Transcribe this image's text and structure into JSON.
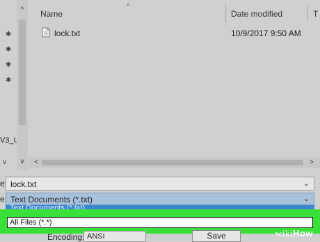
{
  "nav": {
    "label": "V3_U",
    "scroll_up_glyph": "^",
    "scroll_down_glyph": "v",
    "chevron": "v",
    "pin_glyph": "✱"
  },
  "file_list": {
    "columns": {
      "name": "Name",
      "date_modified": "Date modified",
      "type": "T"
    },
    "sort_glyph": "^",
    "files": [
      {
        "name": "lock.txt",
        "date_modified": "10/9/2017 9:50 AM"
      }
    ]
  },
  "hscroll": {
    "left_glyph": "<",
    "right_glyph": ">"
  },
  "form": {
    "filename_label": "e:",
    "filename_value": "lock.txt",
    "savetype_label": "e:",
    "savetype_value": "Text Documents (*.txt)",
    "savetype_list_item": "Text Documents (*.txt)",
    "allfiles_option": "All Files  (*.*)",
    "encoding_label": "Encoding:",
    "encoding_value": "ANSI",
    "save_button": "Save",
    "dropdown_glyph": "⌄"
  },
  "watermark": {
    "wiki": "wiki",
    "how": "How"
  },
  "colors": {
    "highlight": "#3ae03a",
    "selected_type_bg": "#a9c2dc",
    "dropdown_list_bg": "#3c86d0"
  }
}
